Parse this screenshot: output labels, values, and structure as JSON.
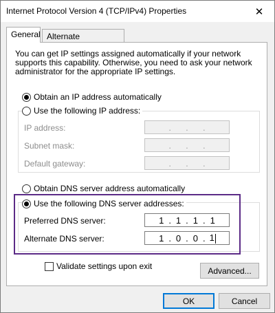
{
  "window": {
    "title": "Internet Protocol Version 4 (TCP/IPv4) Properties",
    "close_glyph": "✕"
  },
  "tabs": [
    {
      "label": "General",
      "selected": true
    },
    {
      "label": "Alternate Configuration",
      "selected": false
    }
  ],
  "general": {
    "info_text": "You can get IP settings assigned automatically if your network supports this capability. Otherwise, you need to ask your network administrator for the appropriate IP settings.",
    "ip_mode": {
      "auto_label": "Obtain an IP address automatically",
      "manual_label": "Use the following IP address:",
      "selected": "auto"
    },
    "ip_fields": [
      {
        "label": "IP address:",
        "octets": [
          "",
          "",
          "",
          ""
        ],
        "enabled": false
      },
      {
        "label": "Subnet mask:",
        "octets": [
          "",
          "",
          "",
          ""
        ],
        "enabled": false
      },
      {
        "label": "Default gateway:",
        "octets": [
          "",
          "",
          "",
          ""
        ],
        "enabled": false
      }
    ],
    "dns_mode": {
      "auto_label": "Obtain DNS server address automatically",
      "manual_label": "Use the following DNS server addresses:",
      "selected": "manual"
    },
    "dns_fields": [
      {
        "label": "Preferred DNS server:",
        "octets": [
          "1",
          "1",
          "1",
          "1"
        ],
        "enabled": true
      },
      {
        "label": "Alternate DNS server:",
        "octets": [
          "1",
          "0",
          "0",
          "1"
        ],
        "enabled": true
      }
    ],
    "validate_label": "Validate settings upon exit",
    "validate_checked": false,
    "advanced_label": "Advanced..."
  },
  "footer": {
    "ok_label": "OK",
    "cancel_label": "Cancel"
  },
  "colors": {
    "highlight_border": "#5b2a86",
    "default_button_border": "#0078d7"
  }
}
